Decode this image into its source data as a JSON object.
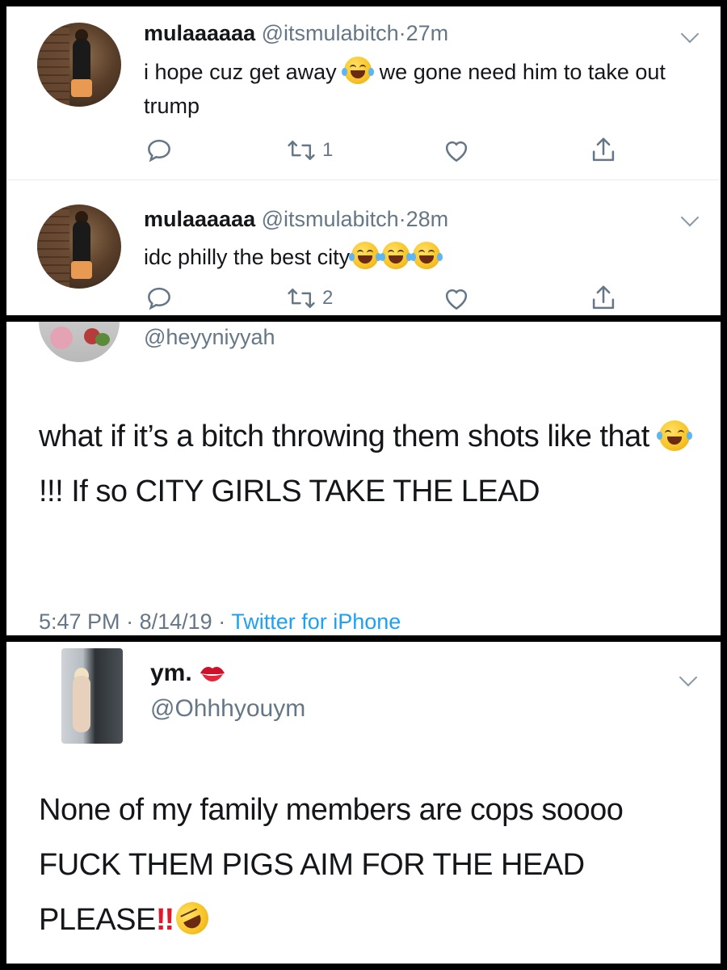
{
  "panel1": {
    "tweets": [
      {
        "name": "mulaaaaaa",
        "handle": "@itsmulabitch",
        "separator": "·",
        "time": "27m",
        "text_before": "i hope cuz get away",
        "text_after": " we gone need him to take out trump",
        "emoji": "face-with-tears-of-joy",
        "retweet_count": "1",
        "reply_count": "",
        "like_count": ""
      },
      {
        "name": "mulaaaaaa",
        "handle": "@itsmulabitch",
        "separator": "·",
        "time": "28m",
        "text_before": "idc philly the best city",
        "emoji": "face-with-tears-of-joy",
        "emoji_count": 3,
        "retweet_count": "2"
      }
    ]
  },
  "panel2": {
    "handle": "@heyyniyyah",
    "text_part1": "what if it’s a bitch throwing them shots like that ",
    "emoji": "face-with-tears-of-joy",
    "text_part2": "!!! If so CITY GIRLS TAKE THE LEAD",
    "time": "5:47 PM",
    "date": "8/14/19",
    "separator": "·",
    "source": "Twitter for iPhone"
  },
  "panel3": {
    "name": "ym.",
    "name_emoji": "kiss-mark",
    "handle": "@Ohhhyouym",
    "text": "None of my family members are cops soooo FUCK THEM PIGS AIM FOR THE HEAD PLEASE",
    "emphasis": "!!",
    "trailing_emoji": "rolling-on-the-floor-laughing"
  },
  "colors": {
    "text": "#14171a",
    "secondary": "#657786",
    "link": "#1da1f2",
    "divider": "#e6ecf0",
    "alert_red": "#e0182c"
  }
}
